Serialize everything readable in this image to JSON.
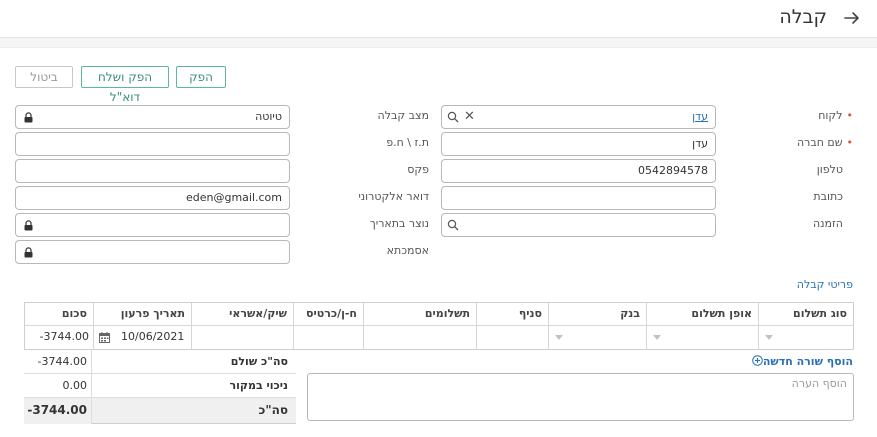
{
  "header": {
    "title": "קבלה"
  },
  "actions": {
    "issue": "הפק",
    "issue_email": "הפק ושלח דוא\"ל",
    "cancel": "ביטול"
  },
  "form": {
    "customer": {
      "label": "לקוח",
      "value": "עדן"
    },
    "company_name": {
      "label": "שם חברה",
      "value": "עדן"
    },
    "phone": {
      "label": "טלפון",
      "value": "0542894578"
    },
    "address": {
      "label": "כתובת",
      "value": ""
    },
    "order": {
      "label": "הזמנה",
      "value": ""
    },
    "receipt_status": {
      "label": "מצב קבלה",
      "value": "טיוטה"
    },
    "id_number": {
      "label": "ת.ז \\ ח.פ",
      "value": ""
    },
    "fax": {
      "label": "פקס",
      "value": ""
    },
    "email": {
      "label": "דואר אלקטרוני",
      "value": "eden@gmail.com"
    },
    "created_date": {
      "label": "נוצר בתאריך",
      "value": ""
    },
    "reference": {
      "label": "אסמכתא",
      "value": ""
    },
    "required_mark": "•"
  },
  "section": {
    "title": "פריטי קבלה"
  },
  "table": {
    "columns": [
      "סוג תשלום",
      "אופן תשלום",
      "בנק",
      "סניף",
      "תשלומים",
      "ח-ן/כרטיס",
      "שיק/אשראי",
      "תאריך פרעון",
      "סכום"
    ],
    "row": {
      "due_date": "10/06/2021",
      "amount": "-3744.00"
    }
  },
  "add_row": {
    "label": "הוסף שורה חדשה"
  },
  "note": {
    "placeholder": "הוסף הערה"
  },
  "totals": {
    "paid": {
      "label": "סה\"כ שולם",
      "value": "-3744.00"
    },
    "withholding": {
      "label": "ניכוי במקור",
      "value": "0.00"
    },
    "total": {
      "label": "סה\"כ",
      "value": "-3744.00"
    }
  }
}
